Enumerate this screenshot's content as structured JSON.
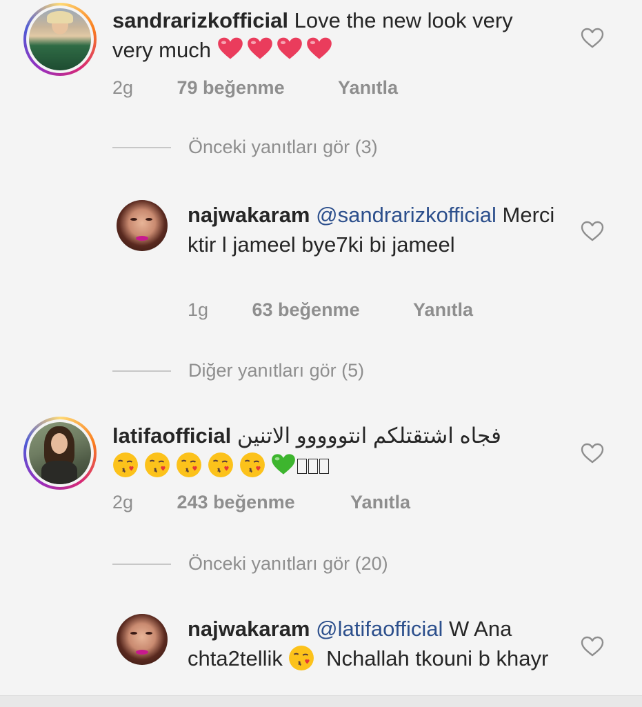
{
  "comments": [
    {
      "username": "sandrarizkofficial",
      "text": "Love the new look very very much",
      "emojis": [
        "heart",
        "heart",
        "heart",
        "heart"
      ],
      "time": "2g",
      "likes": "79 beğenme",
      "reply": "Yanıtla"
    },
    {
      "username": "latifaofficial",
      "text": "فجاه اشتقتلكم انتووووو الاتنين",
      "emojis": [
        "kiss",
        "kiss",
        "kiss",
        "kiss",
        "kiss",
        "green-heart"
      ],
      "time": "2g",
      "likes": "243 beğenme",
      "reply": "Yanıtla"
    }
  ],
  "replies": [
    {
      "username": "najwakaram",
      "mention": "@sandrarizkofficial",
      "text": "Merci ktir l jameel bye7ki bi jameel",
      "time": "1g",
      "likes": "63 beğenme",
      "reply": "Yanıtla"
    },
    {
      "username": "najwakaram",
      "mention": "@latifaofficial",
      "text_before": "W Ana chta2tellik",
      "text_after": "Nchallah tkouni b khayr"
    }
  ],
  "view_replies": [
    "Önceki yanıtları gör (3)",
    "Diğer yanıtları gör (5)",
    "Önceki yanıtları gör (20)"
  ],
  "icons": {
    "like": "heart-outline-icon"
  },
  "colors": {
    "mention": "#2c4f8c",
    "meta": "#8e8e8e",
    "heart_red": "#e8174a",
    "green_heart": "#3db52e"
  }
}
